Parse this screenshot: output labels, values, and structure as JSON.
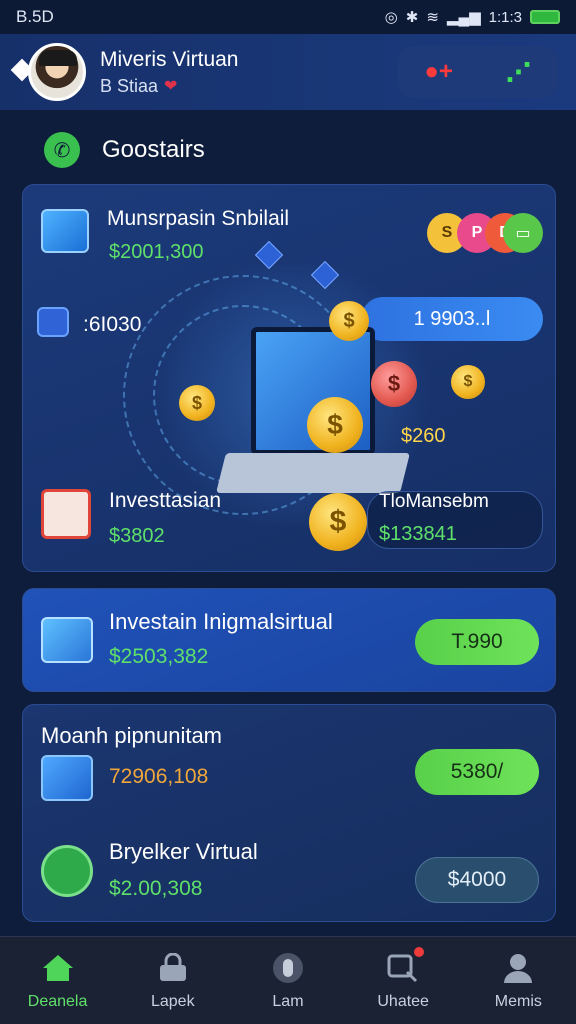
{
  "status_bar": {
    "time": "B.5D",
    "clock": "1:1:3",
    "battery_color": "#2fb83d"
  },
  "header": {
    "name": "Miveris Virtuan",
    "subtitle": "B Stiaa",
    "action_icons": [
      "plus-icon",
      "share-icon"
    ]
  },
  "section": {
    "title": "Goostairs",
    "icon": "phone-icon"
  },
  "hero_card": {
    "title": "Munsrpasin Snbilail",
    "amount": "$2001,300",
    "stat_value": ":6I030",
    "pill_value": "1 9903..l",
    "floating_amount": "$260",
    "investment_label": "Investtasian",
    "investment_amount": "$3802",
    "right_label": "TloMansebm",
    "right_amount": "$133841",
    "chips": [
      "S",
      "P",
      "D"
    ]
  },
  "rows": [
    {
      "title": "Investain Inigmalsirtual",
      "amount": "$2503,382",
      "pill": "T.990",
      "icon": "document-icon",
      "amount_color": "#5fe06a"
    },
    {
      "title": "Moanh pipnunitam",
      "amount": "72906,108",
      "pill": "5380/",
      "icon": "briefcase-icon",
      "amount_color": "#f0a63a"
    },
    {
      "title": "Bryelker Virtual",
      "amount": "$2.00,308",
      "pill": "$4000",
      "icon": "badge-check-icon",
      "amount_color": "#5fe06a"
    }
  ],
  "bottom_nav": [
    {
      "label": "Deanela",
      "icon": "home-icon",
      "active": true
    },
    {
      "label": "Lapek",
      "icon": "lock-icon",
      "active": false
    },
    {
      "label": "Lam",
      "icon": "mouse-icon",
      "active": false
    },
    {
      "label": "Uhatee",
      "icon": "search-notification-icon",
      "active": false
    },
    {
      "label": "Memis",
      "icon": "profile-icon",
      "active": false
    }
  ],
  "colors": {
    "accent_green": "#5fe06a",
    "background": "#0f1d3c",
    "card": "#1c3a7a"
  }
}
